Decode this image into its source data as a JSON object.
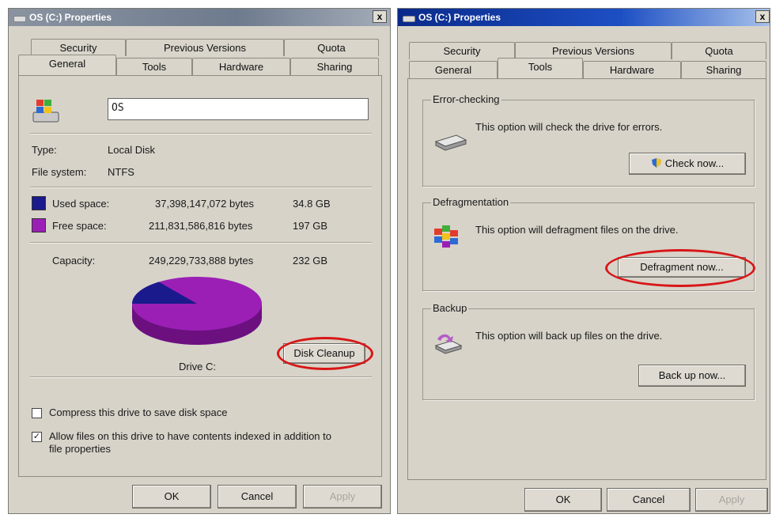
{
  "left_window": {
    "title": "OS (C:) Properties",
    "close_label": "x",
    "tabs_row1": [
      "Security",
      "Previous Versions",
      "Quota"
    ],
    "tabs_row2": [
      "General",
      "Tools",
      "Hardware",
      "Sharing"
    ],
    "active_tab": "General",
    "drive_name": "OS",
    "type_label": "Type:",
    "type_value": "Local Disk",
    "fs_label": "File system:",
    "fs_value": "NTFS",
    "used_label": "Used space:",
    "used_bytes": "37,398,147,072 bytes",
    "used_size": "34.8 GB",
    "used_color": "#1a1a8c",
    "free_label": "Free space:",
    "free_bytes": "211,831,586,816 bytes",
    "free_size": "197 GB",
    "free_color": "#9b1fb5",
    "capacity_label": "Capacity:",
    "capacity_bytes": "249,229,733,888 bytes",
    "capacity_size": "232 GB",
    "used_fraction": 0.15,
    "drive_label": "Drive C:",
    "cleanup_label": "Disk Cleanup",
    "compress_label": "Compress this drive to save disk space",
    "compress_checked": false,
    "index_label_line1": "Allow files on this drive to have contents indexed in addition to",
    "index_label_line2": "file properties",
    "index_checked": true,
    "ok_label": "OK",
    "cancel_label": "Cancel",
    "apply_label": "Apply"
  },
  "right_window": {
    "title": "OS (C:) Properties",
    "close_label": "x",
    "tabs_row1": [
      "Security",
      "Previous Versions",
      "Quota"
    ],
    "tabs_row2": [
      "General",
      "Tools",
      "Hardware",
      "Sharing"
    ],
    "active_tab": "Tools",
    "error_title": "Error-checking",
    "error_text": "This option will check the drive for errors.",
    "check_label": "Check now...",
    "defrag_title": "Defragmentation",
    "defrag_text": "This option will defragment files on the drive.",
    "defrag_label": "Defragment now...",
    "backup_title": "Backup",
    "backup_text": "This option will back up files on the drive.",
    "backup_label": "Back up now...",
    "ok_label": "OK",
    "cancel_label": "Cancel",
    "apply_label": "Apply"
  },
  "colors": {
    "highlight_ring": "#d81616",
    "titlebar_left_gradient": "#7d8a9c",
    "titlebar_right_gradient": "#0a2a8a"
  }
}
